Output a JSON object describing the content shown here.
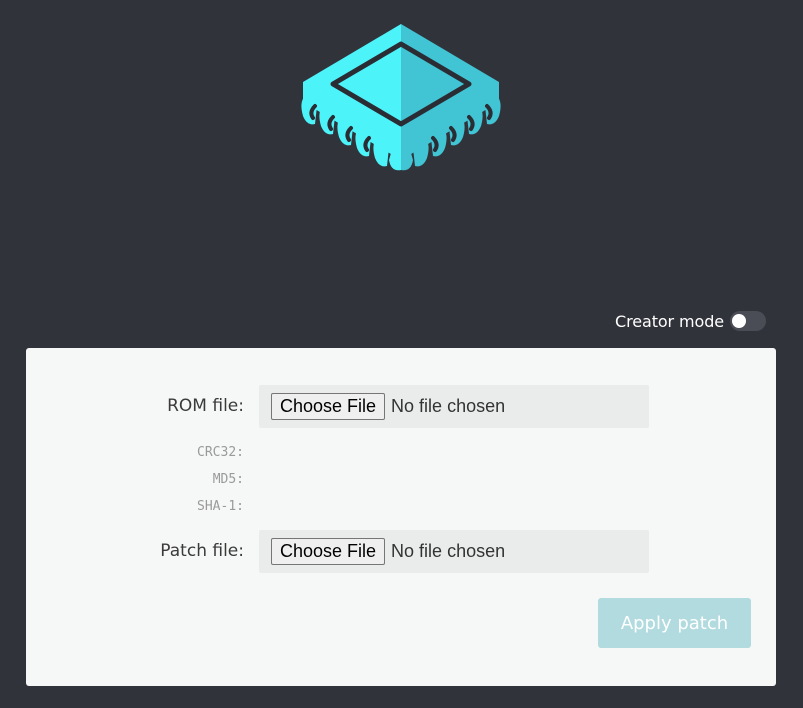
{
  "logo": {
    "icon": "chip-icon",
    "colors": {
      "light": "#4cf3f9",
      "dark": "#41c4d3",
      "outline": "#2b2d35"
    }
  },
  "header": {
    "creator_mode_label": "Creator mode",
    "creator_mode_on": false
  },
  "form": {
    "rom": {
      "label": "ROM file:",
      "button": "Choose File",
      "status": "No file chosen"
    },
    "hashes": {
      "crc32": "CRC32:",
      "md5": "MD5:",
      "sha1": "SHA-1:"
    },
    "patch": {
      "label": "Patch file:",
      "button": "Choose File",
      "status": "No file chosen"
    },
    "apply_label": "Apply patch"
  }
}
